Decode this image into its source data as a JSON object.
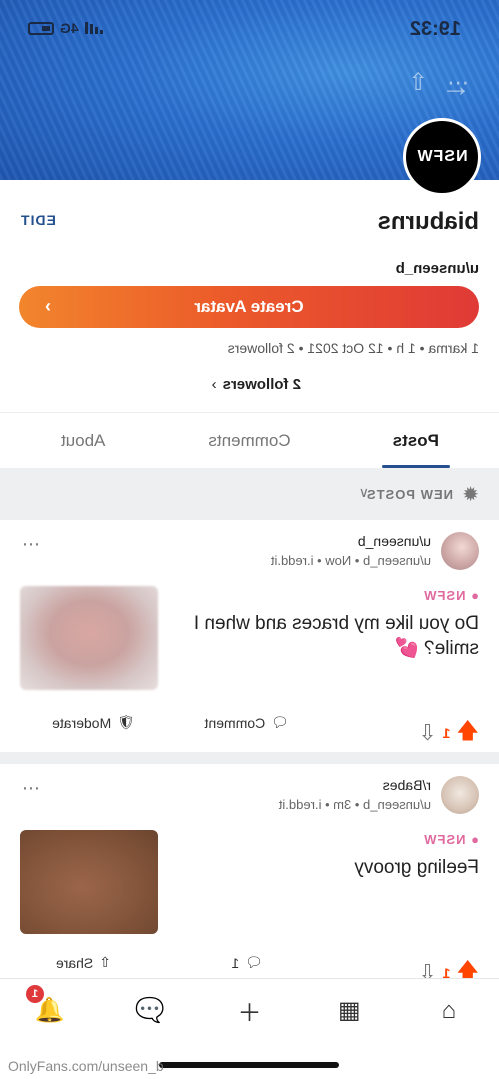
{
  "status_bar": {
    "time": "19:32",
    "network": "4G"
  },
  "header": {
    "back_icon": "arrow-left-icon",
    "share_icon": "share-icon",
    "more_icon": "more-icon",
    "banner_color": "#2a6fcf"
  },
  "profile": {
    "avatar_text": "NSFW",
    "username": "biaburns",
    "edit_label": "EDIT",
    "handle": "u/unseen_b",
    "create_avatar_label": "Create Avatar",
    "create_avatar_gradient": [
      "#e03a36",
      "#f2852c"
    ],
    "meta": "1 karma • 1 h • 12 Oct 2021 • 2 followers",
    "followers_link": "2 followers"
  },
  "tabs": [
    {
      "label": "Posts",
      "active": true
    },
    {
      "label": "Comments",
      "active": false
    },
    {
      "label": "About",
      "active": false
    }
  ],
  "sort": {
    "label": "NEW POSTS"
  },
  "posts": [
    {
      "subreddit": "u/unseen_b",
      "meta": "u/unseen_b • Now • i.redd.it",
      "nsfw": "NSFW",
      "title": "Do you like my braces and when I smile? 💕",
      "score": "1",
      "comment_label": "Comment",
      "third_label": "Moderate"
    },
    {
      "subreddit": "r/Babes",
      "meta": "u/unseen_b • 3m • i.redd.it",
      "nsfw": "NSFW",
      "title": "Feeling groovy",
      "score": "1",
      "comment_count": "1",
      "third_label": "Share"
    }
  ],
  "bottom_nav": {
    "items": [
      "home-icon",
      "grid-icon",
      "plus-icon",
      "chat-icon",
      "bell-icon"
    ],
    "notification_count": "1"
  },
  "watermark": "OnlyFans.com/unseen_b",
  "colors": {
    "accent": "#24508f",
    "upvote": "#ff4500",
    "nsfw": "#e06a9f"
  }
}
